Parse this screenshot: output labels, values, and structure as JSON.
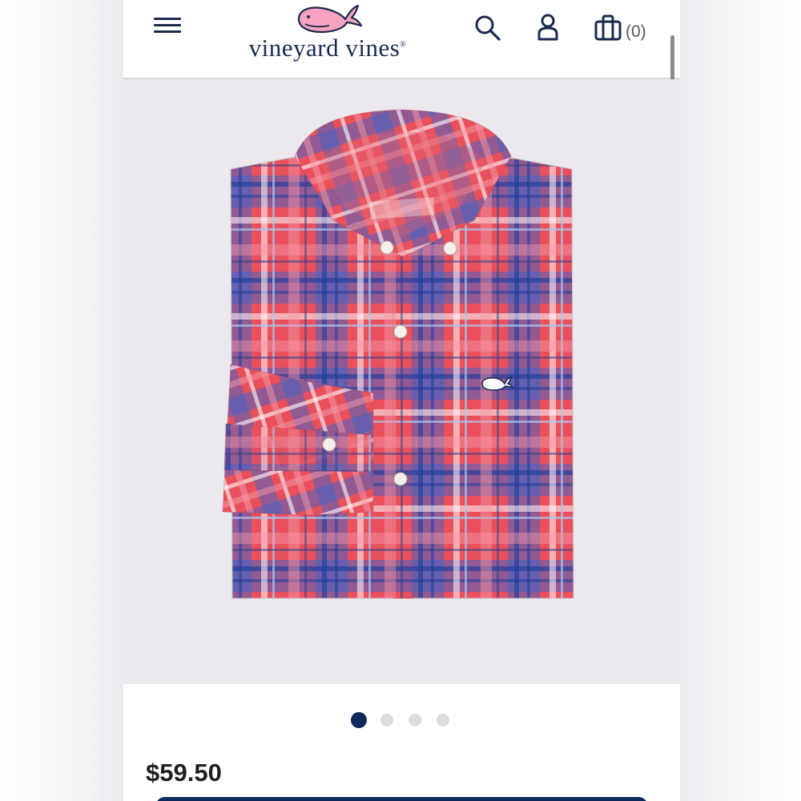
{
  "header": {
    "brand_name": "vineyard vines",
    "trademark": "®",
    "cart_count": "(0)",
    "icons": [
      "hamburger-menu-icon",
      "search-icon",
      "account-icon",
      "shopping-bag-icon"
    ]
  },
  "product": {
    "price": "$59.50",
    "image_count": 4,
    "active_image_index": 0
  },
  "colors": {
    "brand_navy": "#1b2a4e",
    "whale_pink": "#f7a3bf",
    "active_dot": "#0c2a5c",
    "inactive_dot": "#dcdcdf",
    "image_background": "#ebe9ee",
    "plaid_red": "#e9505c",
    "plaid_blue": "#3c63c8"
  }
}
